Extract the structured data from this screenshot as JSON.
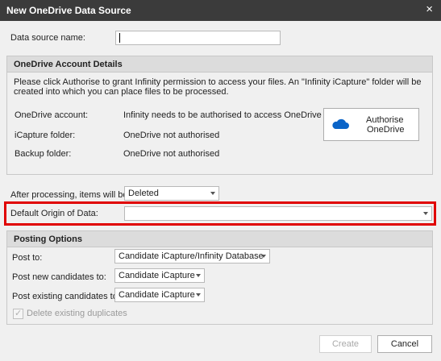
{
  "window": {
    "title": "New OneDrive Data Source",
    "close_icon": "×"
  },
  "data_source": {
    "label": "Data source name:",
    "value": ""
  },
  "account": {
    "header": "OneDrive Account Details",
    "description": "Please click Authorise to grant Infinity permission to access your files. An \"Infinity iCapture\" folder will be created into which you can place files to be processed.",
    "rows": [
      {
        "label": "OneDrive account:",
        "value": "Infinity needs to be authorised to access OneDrive"
      },
      {
        "label": "iCapture folder:",
        "value": "OneDrive not authorised"
      },
      {
        "label": "Backup folder:",
        "value": "OneDrive not authorised"
      }
    ],
    "authorise_button": {
      "line1": "Authorise",
      "line2": "OneDrive",
      "icon": "onedrive-cloud-icon",
      "icon_color": "#0a64c8"
    }
  },
  "after_processing": {
    "label": "After processing, items will be",
    "value": "Deleted"
  },
  "default_origin": {
    "label": "Default Origin of Data:",
    "value": "",
    "highlight_color": "#e00000"
  },
  "posting": {
    "header": "Posting Options",
    "post_to": {
      "label": "Post to:",
      "value": "Candidate iCapture/Infinity Database"
    },
    "post_new": {
      "label": "Post new candidates to:",
      "value": "Candidate iCapture"
    },
    "post_existing": {
      "label": "Post existing candidates to:",
      "value": "Candidate iCapture"
    },
    "delete_duplicates": {
      "label": "Delete existing duplicates",
      "checked": true,
      "enabled": false
    }
  },
  "footer": {
    "create": "Create",
    "cancel": "Cancel"
  }
}
